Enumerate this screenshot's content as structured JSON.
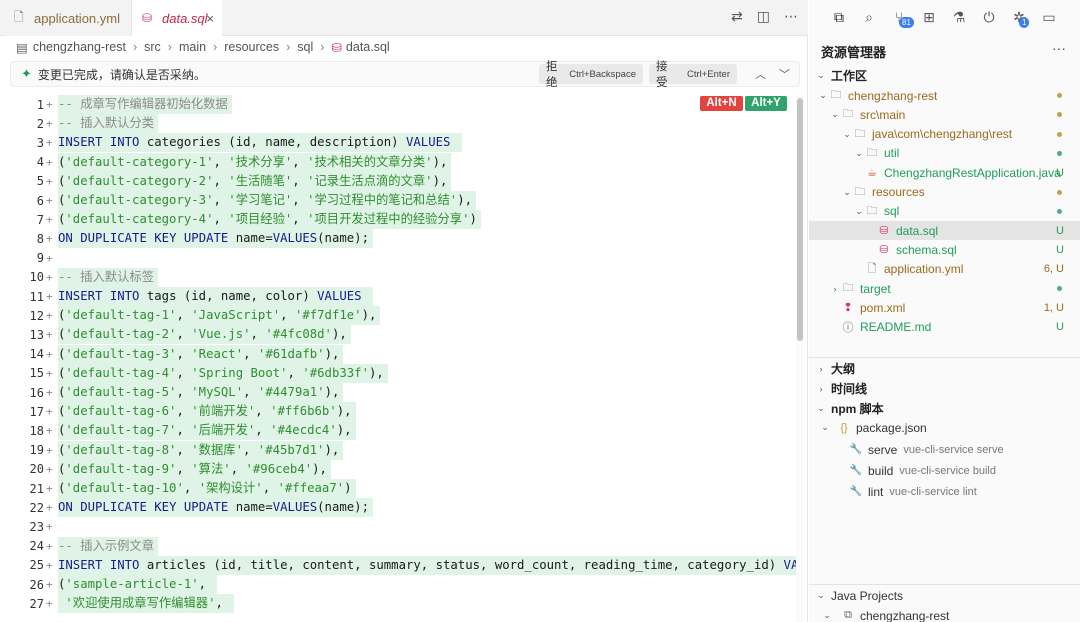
{
  "tabs": [
    {
      "label": "application.yml",
      "icon": "file-icon"
    },
    {
      "label": "data.sql",
      "icon": "database-icon",
      "close": "×"
    }
  ],
  "breadcrumb": [
    "chengzhang-rest",
    "src",
    "main",
    "resources",
    "sql",
    "data.sql"
  ],
  "diffbar": {
    "message": "变更已完成，请确认是否采纳。",
    "reject_label": "拒绝",
    "reject_shortcut": "Ctrl+Backspace",
    "accept_label": "接受",
    "accept_shortcut": "Ctrl+Enter"
  },
  "badges": {
    "reject": "Alt+N",
    "accept": "Alt+Y"
  },
  "code_lines": [
    {
      "n": "1",
      "text": "-- 成章写作编辑器初始化数据",
      "type": "comment"
    },
    {
      "n": "2",
      "text": "-- 插入默认分类",
      "type": "comment"
    },
    {
      "n": "3",
      "text": "INSERT INTO categories (id, name, description) VALUES ",
      "type": "sql"
    },
    {
      "n": "4",
      "text": "('default-category-1', '技术分享', '技术相关的文章分类'),",
      "type": "sql"
    },
    {
      "n": "5",
      "text": "('default-category-2', '生活随笔', '记录生活点滴的文章'),",
      "type": "sql"
    },
    {
      "n": "6",
      "text": "('default-category-3', '学习笔记', '学习过程中的笔记和总结'),",
      "type": "sql"
    },
    {
      "n": "7",
      "text": "('default-category-4', '项目经验', '项目开发过程中的经验分享')",
      "type": "sql"
    },
    {
      "n": "8",
      "text": "ON DUPLICATE KEY UPDATE name=VALUES(name);",
      "type": "sql"
    },
    {
      "n": "9",
      "text": "",
      "type": "blank"
    },
    {
      "n": "10",
      "text": "-- 插入默认标签",
      "type": "comment"
    },
    {
      "n": "11",
      "text": "INSERT INTO tags (id, name, color) VALUES ",
      "type": "sql"
    },
    {
      "n": "12",
      "text": "('default-tag-1', 'JavaScript', '#f7df1e'),",
      "type": "sql"
    },
    {
      "n": "13",
      "text": "('default-tag-2', 'Vue.js', '#4fc08d'),",
      "type": "sql"
    },
    {
      "n": "14",
      "text": "('default-tag-3', 'React', '#61dafb'),",
      "type": "sql"
    },
    {
      "n": "15",
      "text": "('default-tag-4', 'Spring Boot', '#6db33f'),",
      "type": "sql"
    },
    {
      "n": "16",
      "text": "('default-tag-5', 'MySQL', '#4479a1'),",
      "type": "sql"
    },
    {
      "n": "17",
      "text": "('default-tag-6', '前端开发', '#ff6b6b'),",
      "type": "sql"
    },
    {
      "n": "18",
      "text": "('default-tag-7', '后端开发', '#4ecdc4'),",
      "type": "sql"
    },
    {
      "n": "19",
      "text": "('default-tag-8', '数据库', '#45b7d1'),",
      "type": "sql"
    },
    {
      "n": "20",
      "text": "('default-tag-9', '算法', '#96ceb4'),",
      "type": "sql"
    },
    {
      "n": "21",
      "text": "('default-tag-10', '架构设计', '#ffeaa7')",
      "type": "sql"
    },
    {
      "n": "22",
      "text": "ON DUPLICATE KEY UPDATE name=VALUES(name);",
      "type": "sql"
    },
    {
      "n": "23",
      "text": "",
      "type": "blank"
    },
    {
      "n": "24",
      "text": "-- 插入示例文章",
      "type": "comment"
    },
    {
      "n": "25",
      "text": "INSERT INTO articles (id, title, content, summary, status, word_count, reading_time, category_id) VALUES ",
      "type": "sql"
    },
    {
      "n": "26",
      "text": "('sample-article-1', ",
      "type": "sql"
    },
    {
      "n": "27",
      "text": " '欢迎使用成章写作编辑器', ",
      "type": "sql"
    }
  ],
  "sidebar": {
    "title": "资源管理器",
    "more": "···",
    "workspace_label": "工作区",
    "tree": [
      {
        "label": "chengzhang-rest",
        "depth": 0,
        "arrow": "⌄",
        "icon": "folder-icon",
        "color": "orange",
        "dot": "y"
      },
      {
        "label": "src\\main",
        "depth": 1,
        "arrow": "⌄",
        "icon": "folder-icon",
        "color": "orange",
        "dot": "y"
      },
      {
        "label": "java\\com\\chengzhang\\rest",
        "depth": 2,
        "arrow": "⌄",
        "icon": "folder-icon",
        "color": "orange",
        "dot": "y"
      },
      {
        "label": "util",
        "depth": 3,
        "arrow": "⌄",
        "icon": "folder-icon",
        "color": "green",
        "dot": "g"
      },
      {
        "label": "ChengzhangRestApplication.java",
        "depth": 3,
        "arrow": "",
        "icon": "java-icon",
        "color": "green",
        "stat": "U"
      },
      {
        "label": "resources",
        "depth": 2,
        "arrow": "⌄",
        "icon": "folder-icon",
        "color": "orange",
        "dot": "y"
      },
      {
        "label": "sql",
        "depth": 3,
        "arrow": "⌄",
        "icon": "folder-icon",
        "color": "green",
        "dot": "g"
      },
      {
        "label": "data.sql",
        "depth": 4,
        "arrow": "",
        "icon": "database-icon",
        "color": "green",
        "stat": "U",
        "selected": true
      },
      {
        "label": "schema.sql",
        "depth": 4,
        "arrow": "",
        "icon": "database-icon",
        "color": "green",
        "stat": "U"
      },
      {
        "label": "application.yml",
        "depth": 3,
        "arrow": "",
        "icon": "file-icon",
        "color": "orange",
        "stat": "6, U"
      },
      {
        "label": "target",
        "depth": 1,
        "arrow": "›",
        "icon": "folder-icon",
        "color": "green",
        "dot": "g"
      },
      {
        "label": "pom.xml",
        "depth": 1,
        "arrow": "",
        "icon": "xml-icon",
        "color": "orange",
        "stat": "1, U"
      },
      {
        "label": "README.md",
        "depth": 1,
        "arrow": "",
        "icon": "info-icon",
        "color": "green",
        "stat": "U"
      }
    ],
    "sections": [
      "大纲",
      "时间线",
      "npm 脚本"
    ],
    "npm_file": "package.json",
    "scripts": [
      {
        "name": "serve",
        "cmd": "vue-cli-service serve"
      },
      {
        "name": "build",
        "cmd": "vue-cli-service build"
      },
      {
        "name": "lint",
        "cmd": "vue-cli-service lint"
      }
    ],
    "java_projects": "Java Projects",
    "java_project_item": "chengzhang-rest"
  },
  "activity": [
    {
      "icon": "files-icon",
      "badge": ""
    },
    {
      "icon": "search-icon",
      "badge": ""
    },
    {
      "icon": "source-control-icon",
      "badge": "81"
    },
    {
      "icon": "extensions-icon",
      "badge": ""
    },
    {
      "icon": "flask-icon",
      "badge": ""
    },
    {
      "icon": "power-icon",
      "badge": ""
    },
    {
      "icon": "debug-icon",
      "badge": "1"
    },
    {
      "icon": "remote-icon",
      "badge": ""
    }
  ]
}
